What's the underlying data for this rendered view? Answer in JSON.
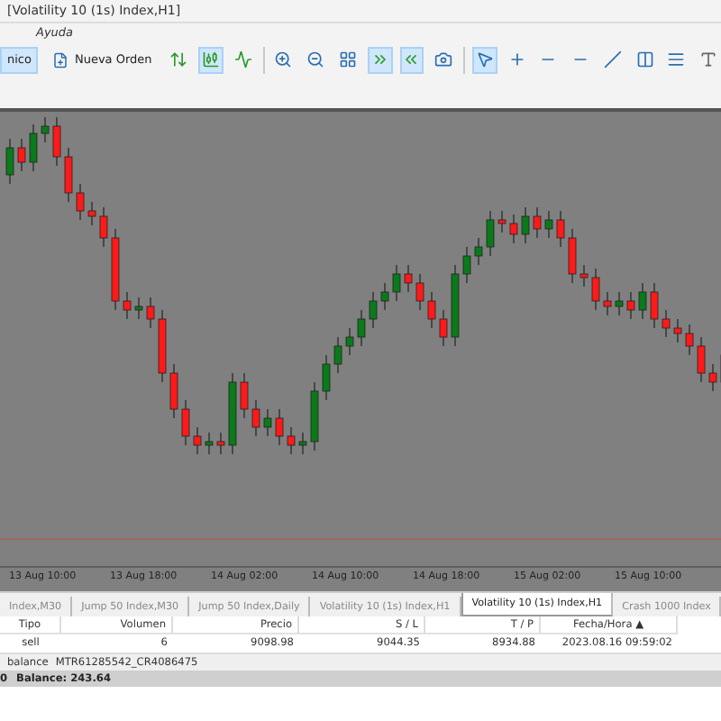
{
  "window": {
    "title": "[Volatility 10 (1s) Index,H1]"
  },
  "menu": [
    "Ayuda"
  ],
  "toolbar": {
    "buttons": [
      {
        "label": "nico",
        "selected": true
      },
      {
        "label": "Nueva Orden",
        "selected": false
      }
    ]
  },
  "chart": {
    "time_labels": [
      "13 Aug 10:00",
      "13 Aug 18:00",
      "14 Aug 02:00",
      "14 Aug 10:00",
      "14 Aug 18:00",
      "15 Aug 02:00",
      "15 Aug 10:00"
    ]
  },
  "chart_tabs": [
    {
      "label": "Index,M30",
      "selected": false
    },
    {
      "label": "Jump 50 Index,M30",
      "selected": false
    },
    {
      "label": "Jump 50 Index,Daily",
      "selected": false
    },
    {
      "label": "Volatility 10 (1s) Index,H1",
      "selected": false
    },
    {
      "label": "Volatility 10 (1s) Index,H1",
      "selected": true
    },
    {
      "label": "Crash 1000 Index",
      "selected": false
    }
  ],
  "table": {
    "columns": [
      "Tipo",
      "Volumen",
      "Precio",
      "S / L",
      "T / P",
      "Fecha/Hora ▲"
    ],
    "rows": [
      [
        "sell",
        "6",
        "9098.98",
        "9044.35",
        "8934.88",
        "2023.08.16 09:59:02"
      ]
    ]
  },
  "account_row": {
    "label": "balance",
    "value": "MTR61285542_CR4086475"
  },
  "balance_bar": {
    "prefix": "0",
    "text": "Balance: 243.64"
  }
}
